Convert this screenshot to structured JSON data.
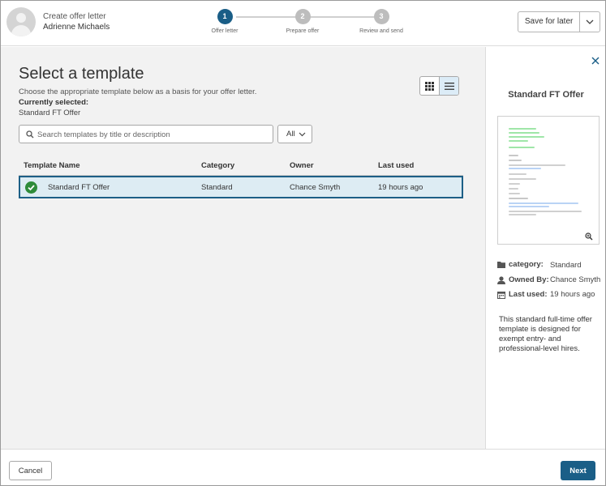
{
  "header": {
    "title": "Create offer letter",
    "candidate_name": "Adrienne Michaels",
    "save_label": "Save for later"
  },
  "stepper": {
    "steps": [
      {
        "number": "1",
        "label": "Offer letter",
        "state": "active"
      },
      {
        "number": "2",
        "label": "Prepare offer",
        "state": "upcoming"
      },
      {
        "number": "3",
        "label": "Review and send",
        "state": "upcoming"
      }
    ]
  },
  "main": {
    "title": "Select a template",
    "subtitle": "Choose the appropriate template below as a basis for your offer letter.",
    "currently_selected_label": "Currently selected:",
    "currently_selected_value": "Standard FT Offer",
    "view_mode": "list",
    "search": {
      "placeholder": "Search templates by title or description",
      "value": ""
    },
    "filter": {
      "selected": "All"
    },
    "table": {
      "columns": [
        "Template Name",
        "Category",
        "Owner",
        "Last used"
      ],
      "rows": [
        {
          "name": "Standard FT Offer",
          "category": "Standard",
          "owner": "Chance Smyth",
          "last_used": "19 hours ago",
          "selected": true
        }
      ]
    }
  },
  "side_panel": {
    "title": "Standard FT Offer",
    "category_label": "category:",
    "category_value": "Standard",
    "owner_label": "Owned By:",
    "owner_value": "Chance Smyth",
    "last_used_label": "Last used:",
    "last_used_value": "19 hours ago",
    "description": "This standard full-time offer template is designed for exempt entry- and professional-level hires."
  },
  "footer": {
    "cancel_label": "Cancel",
    "next_label": "Next"
  },
  "colors": {
    "accent": "#1a5e87",
    "selected_row_bg": "#ddecf3",
    "success": "#2e8b3a"
  }
}
